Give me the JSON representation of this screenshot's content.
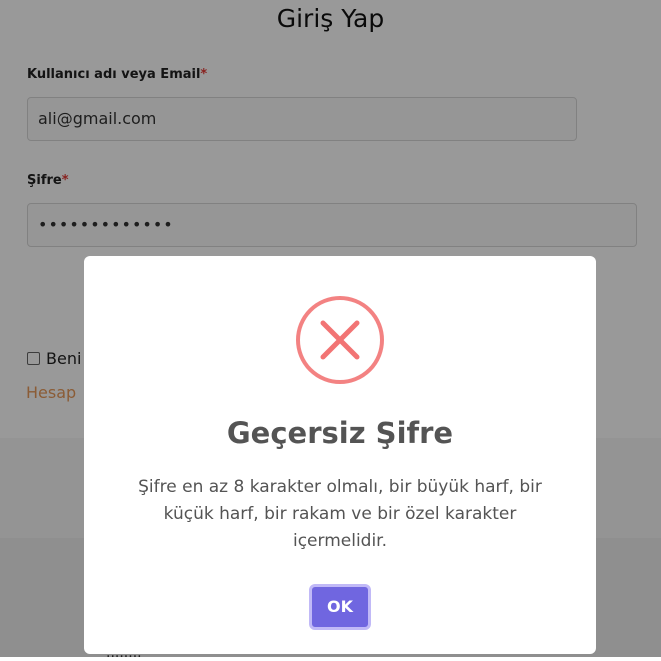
{
  "login": {
    "title": "Giriş Yap",
    "username_label": "Kullanıcı adı veya Email",
    "username_value": "ali@gmail.com",
    "password_label": "Şifre",
    "password_value": "•••••••••••••",
    "required_mark": "*",
    "remember_label": "Beni",
    "create_account_link": "Hesap",
    "footer_text": "........"
  },
  "modal": {
    "icon": "error-x-icon",
    "icon_color": "#f27474",
    "title": "Geçersiz Şifre",
    "message": "Şifre en az 8 karakter olmalı, bir büyük harf, bir küçük harf, bir rakam ve bir özel karakter içermelidir.",
    "ok_label": "OK",
    "ok_color": "#7066e0"
  }
}
